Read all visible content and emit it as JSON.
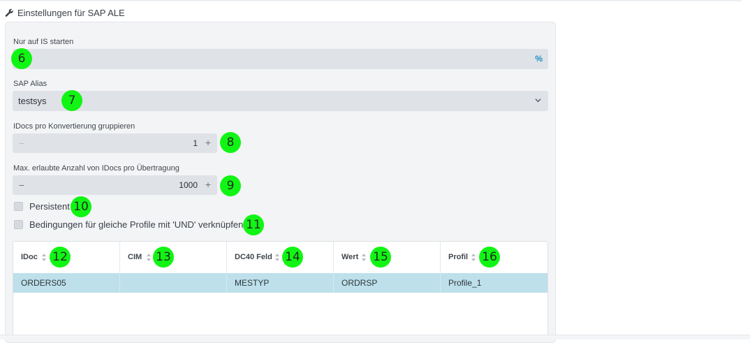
{
  "section": {
    "title": "Einstellungen für SAP ALE",
    "icon": "wrench-icon"
  },
  "fields": {
    "is_start": {
      "label": "Nur auf IS starten",
      "value": "",
      "icon": "percent-icon"
    },
    "sap_alias": {
      "label": "SAP Alias",
      "value": "testsys",
      "icon": "chevron-down-icon"
    },
    "idocs_group": {
      "label": "IDocs pro Konvertierung gruppieren",
      "value": "1",
      "minus": "−",
      "plus": "+"
    },
    "max_idocs": {
      "label": "Max. erlaubte Anzahl von IDocs pro Übertragung",
      "value": "1000",
      "minus": "−",
      "plus": "+"
    }
  },
  "checkboxes": {
    "persistent": {
      "label": "Persistent",
      "checked": false
    },
    "und": {
      "label": "Bedingungen für gleiche Profile mit 'UND' verknüpfen",
      "checked": false
    }
  },
  "table": {
    "columns": [
      "IDoc",
      "CIM",
      "DC40 Feld",
      "Wert",
      "Profil"
    ],
    "rows": [
      [
        "ORDERS05",
        "",
        "MESTYP",
        "ORDRSP",
        "Profile_1"
      ]
    ]
  },
  "markers": [
    "6",
    "7",
    "8",
    "9",
    "10",
    "11",
    "12",
    "13",
    "14",
    "15",
    "16"
  ],
  "colors": {
    "marker": "#11f514",
    "row_selected": "#bde0eb",
    "accent": "#1b8fc4",
    "field_bg": "#dfe2e7"
  }
}
